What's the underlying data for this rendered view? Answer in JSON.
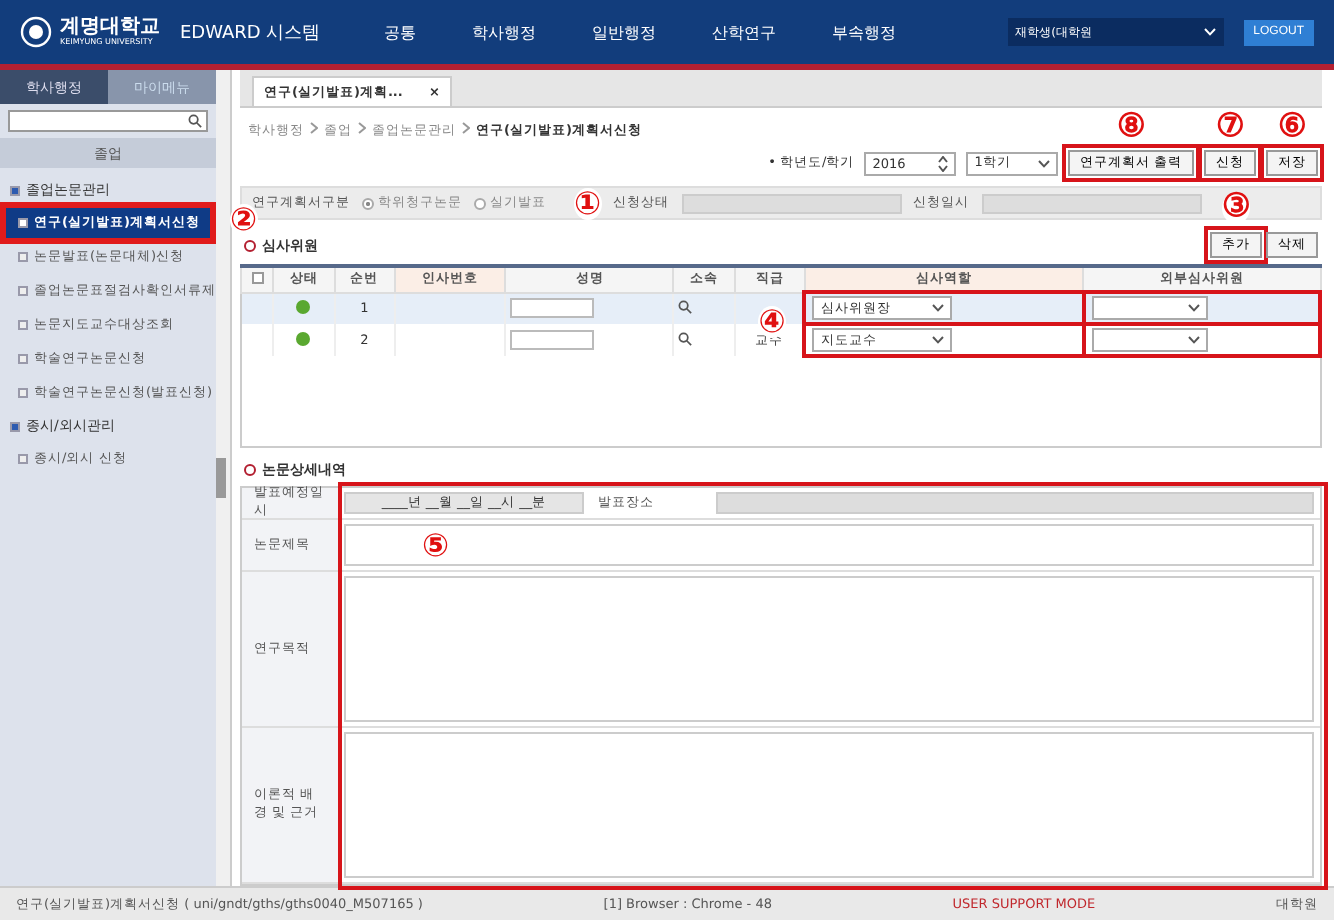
{
  "header": {
    "logo_title": "계명대학교",
    "logo_subtitle": "KEIMYUNG UNIVERSITY",
    "system_name": "EDWARD 시스템",
    "menu": [
      "공통",
      "학사행정",
      "일반행정",
      "산학연구",
      "부속행정"
    ],
    "user": "재학생(대학원",
    "logout": "LOGOUT"
  },
  "sidebar": {
    "tabs": [
      {
        "label": "학사행정",
        "selected": true
      },
      {
        "label": "마이메뉴",
        "selected": false
      }
    ],
    "category": "졸업",
    "tree": [
      {
        "label": "졸업논문관리",
        "expanded": true,
        "children": [
          {
            "label": "연구(실기발표)계획서신청",
            "selected": true,
            "callout": "②"
          },
          {
            "label": "논문발표(논문대체)신청",
            "selected": false
          },
          {
            "label": "졸업논문표절검사확인서류제",
            "selected": false
          },
          {
            "label": "논문지도교수대상조회",
            "selected": false
          },
          {
            "label": "학술연구논문신청",
            "selected": false
          },
          {
            "label": "학술연구논문신청(발표신청)",
            "selected": false
          }
        ]
      },
      {
        "label": "종시/외시관리",
        "expanded": true,
        "children": [
          {
            "label": "종시/외시 신청",
            "selected": false
          }
        ]
      }
    ]
  },
  "page_tab": {
    "label": "연구(실기발표)계획...",
    "close": "×"
  },
  "breadcrumb": [
    "학사행정",
    "졸업",
    "졸업논문관리",
    "연구(실기발표)계획서신청"
  ],
  "term": {
    "label": "• 학년도/학기",
    "year": "2016",
    "semester": "1학기"
  },
  "actions": [
    {
      "label": "연구계획서 출력",
      "callout": "⑧"
    },
    {
      "label": "신청",
      "callout": "⑦"
    },
    {
      "label": "저장",
      "callout": "⑥"
    }
  ],
  "form": {
    "type_label": "연구계획서구분",
    "options": [
      {
        "label": "학위청구논문",
        "selected": true
      },
      {
        "label": "실기발표",
        "selected": false
      }
    ],
    "callout": "①",
    "status_label": "신청상태",
    "date_label": "신청일시"
  },
  "committee": {
    "title": "심사위원",
    "buttons": [
      {
        "label": "추가",
        "callout": "③"
      },
      {
        "label": "삭제"
      }
    ],
    "columns": [
      "상태",
      "순번",
      "인사번호",
      "성명",
      "소속",
      "직급",
      "심사역할",
      "외부심사위원"
    ],
    "roles_callout": "④",
    "all_checked": false,
    "rows": [
      {
        "selected": true,
        "number": "1",
        "role": "심사위원장"
      },
      {
        "selected": false,
        "number": "2",
        "rank": "교수",
        "role": "지도교수"
      }
    ]
  },
  "details": {
    "title": "논문상세내역",
    "callout": "⑤",
    "date_label": "발표예정일시",
    "date_value": "____년 __월 __일 __시 __분",
    "place_label": "발표장소",
    "fields": [
      {
        "label": "논문제목",
        "kind": "line"
      },
      {
        "label": "연구목적",
        "kind": "area"
      },
      {
        "label": "이론적 배경 및 근거",
        "kind": "area"
      }
    ]
  },
  "status_bar": {
    "path": "연구(실기발표)계획서신청 ( uni/gndt/gths/gths0040_M507165 )",
    "browser": "[1] Browser : Chrome - 48",
    "mode": "USER SUPPORT MODE",
    "user": "대학원"
  }
}
